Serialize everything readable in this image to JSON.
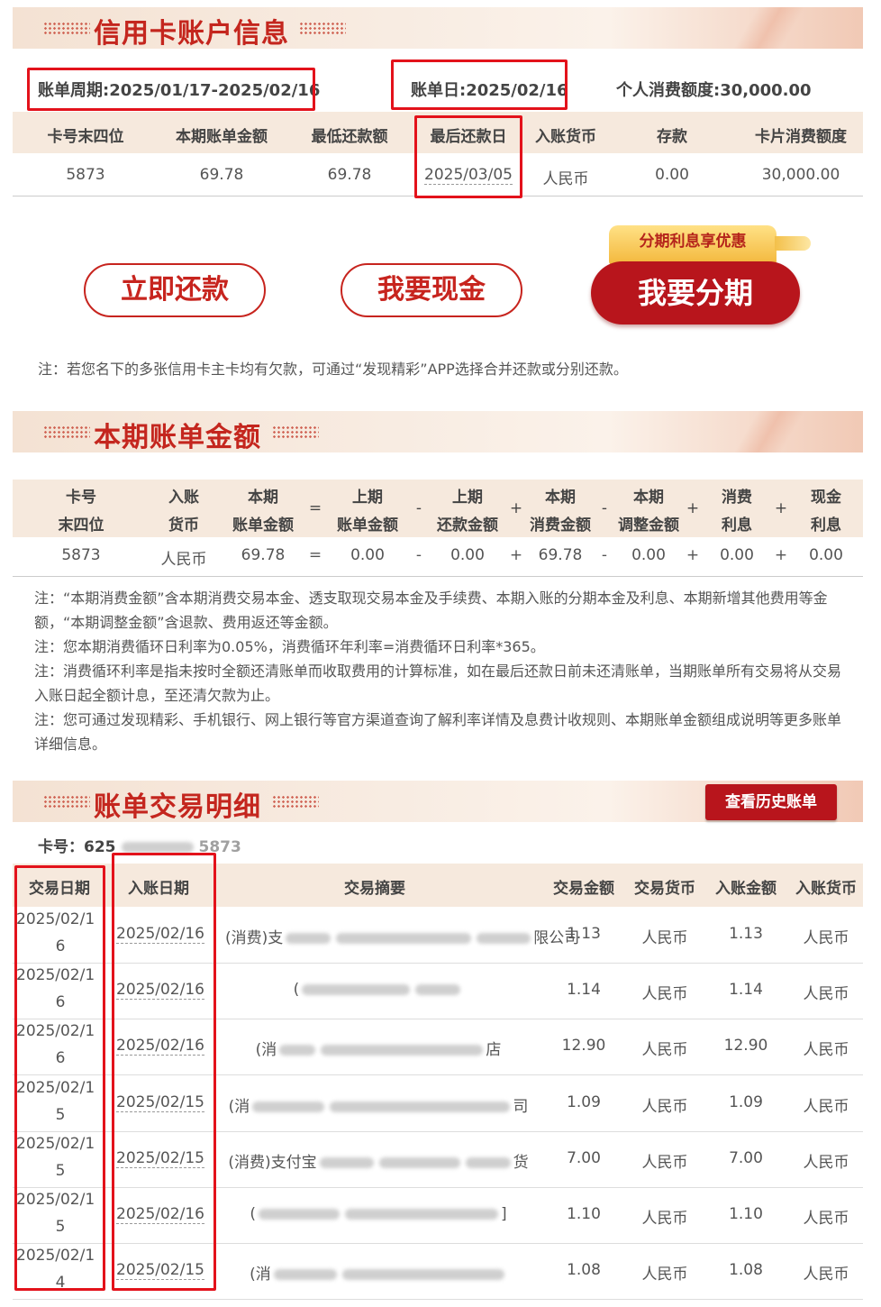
{
  "section1": {
    "title": "信用卡账户信息",
    "period": "账单周期:2025/01/17-2025/02/16",
    "bill_date": "账单日:2025/02/16",
    "credit_limit": "个人消费额度:30,000.00",
    "headers": [
      "卡号末四位",
      "本期账单金额",
      "最低还款额",
      "最后还款日",
      "入账货币",
      "存款",
      "卡片消费额度"
    ],
    "values": [
      "5873",
      "69.78",
      "69.78",
      "2025/03/05",
      "人民币",
      "0.00",
      "30,000.00"
    ]
  },
  "actions": {
    "repay": "立即还款",
    "cash": "我要现金",
    "installment": "我要分期",
    "promo": "分期利息享优惠"
  },
  "note1": "注：若您名下的多张信用卡主卡均有欠款，可通过“发现精彩”APP选择合并还款或分别还款。",
  "section2": {
    "title": "本期账单金额",
    "headers_top": [
      "卡号",
      "入账",
      "本期",
      "",
      "上期",
      "",
      "上期",
      "",
      "本期",
      "",
      "本期",
      "",
      "消费",
      "",
      "现金"
    ],
    "headers_bottom": [
      "末四位",
      "货币",
      "账单金额",
      "=",
      "账单金额",
      "-",
      "还款金额",
      "+",
      "消费金额",
      "-",
      "调整金额",
      "+",
      "利息",
      "+",
      "利息"
    ],
    "values": [
      "5873",
      "人民币",
      "69.78",
      "=",
      "0.00",
      "-",
      "0.00",
      "+",
      "69.78",
      "-",
      "0.00",
      "+",
      "0.00",
      "+",
      "0.00"
    ]
  },
  "notes2": [
    "注：“本期消费金额”含本期消费交易本金、透支取现交易本金及手续费、本期入账的分期本金及利息、本期新增其他费用等金额，“本期调整金额”含退款、费用返还等金额。",
    "注：您本期消费循环日利率为0.05%，消费循环年利率=消费循环日利率*365。",
    "注：消费循环利率是指未按时全额还清账单而收取费用的计算标准，如在最后还款日前未还清账单，当期账单所有交易将从交易入账日起全额计息，至还清欠款为止。",
    "注：您可通过发现精彩、手机银行、网上银行等官方渠道查询了解利率详情及息费计收规则、本期账单金额组成说明等更多账单详细信息。"
  ],
  "section3": {
    "title": "账单交易明细",
    "history_button": "查看历史账单",
    "card_label": "卡号：625",
    "card_tail": "5873",
    "headers": [
      "交易日期",
      "入账日期",
      "交易摘要",
      "交易金额",
      "交易货币",
      "入账金额",
      "入账货币"
    ],
    "rows": [
      {
        "tdate1": "2025/02/1",
        "tdate2": "6",
        "pdate": "2025/02/16",
        "pre": "(消费)支",
        "post": "限公司",
        "amt": "1.13",
        "cur": "人民币",
        "pamt": "1.13",
        "pcur": "人民币"
      },
      {
        "tdate1": "2025/02/1",
        "tdate2": "6",
        "pdate": "2025/02/16",
        "pre": "(",
        "post": "",
        "amt": "1.14",
        "cur": "人民币",
        "pamt": "1.14",
        "pcur": "人民币"
      },
      {
        "tdate1": "2025/02/1",
        "tdate2": "6",
        "pdate": "2025/02/16",
        "pre": "(消",
        "post": "店",
        "amt": "12.90",
        "cur": "人民币",
        "pamt": "12.90",
        "pcur": "人民币"
      },
      {
        "tdate1": "2025/02/1",
        "tdate2": "5",
        "pdate": "2025/02/15",
        "pre": "(消",
        "post": "司",
        "amt": "1.09",
        "cur": "人民币",
        "pamt": "1.09",
        "pcur": "人民币"
      },
      {
        "tdate1": "2025/02/1",
        "tdate2": "5",
        "pdate": "2025/02/15",
        "pre": "(消费)支付宝",
        "post": "货",
        "amt": "7.00",
        "cur": "人民币",
        "pamt": "7.00",
        "pcur": "人民币"
      },
      {
        "tdate1": "2025/02/1",
        "tdate2": "5",
        "pdate": "2025/02/16",
        "pre": "(",
        "post": "]",
        "amt": "1.10",
        "cur": "人民币",
        "pamt": "1.10",
        "pcur": "人民币"
      },
      {
        "tdate1": "2025/02/1",
        "tdate2": "4",
        "pdate": "2025/02/15",
        "pre": "(消",
        "post": "",
        "amt": "1.08",
        "cur": "人民币",
        "pamt": "1.08",
        "pcur": "人民币"
      }
    ]
  },
  "colors": {
    "brand_red": "#c4261e",
    "highlight_red": "#e3121b",
    "header_bg": "#f6e9dd"
  }
}
